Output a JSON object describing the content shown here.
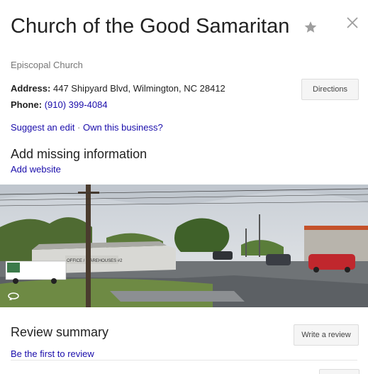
{
  "place": {
    "name": "Church of the Good Samaritan",
    "category": "Episcopal Church",
    "address_label": "Address:",
    "address": "447 Shipyard Blvd, Wilmington, NC 28412",
    "phone_label": "Phone:",
    "phone": "(910) 399-4084"
  },
  "actions": {
    "directions": "Directions",
    "suggest_edit": "Suggest an edit",
    "separator": "·",
    "own_business": "Own this business?"
  },
  "missing_info": {
    "heading": "Add missing information",
    "add_website": "Add website"
  },
  "photo": {
    "sign_text": "OFFICE / WAREHOUSES #2",
    "icon": "street-view-360-icon"
  },
  "reviews": {
    "heading": "Review summary",
    "write_review": "Write a review",
    "first_review": "Be the first to review"
  },
  "icons": {
    "star": "star-icon",
    "close": "close-icon"
  },
  "colors": {
    "link": "#1a0dab",
    "button_bg": "#f5f5f5",
    "muted": "#777777"
  }
}
